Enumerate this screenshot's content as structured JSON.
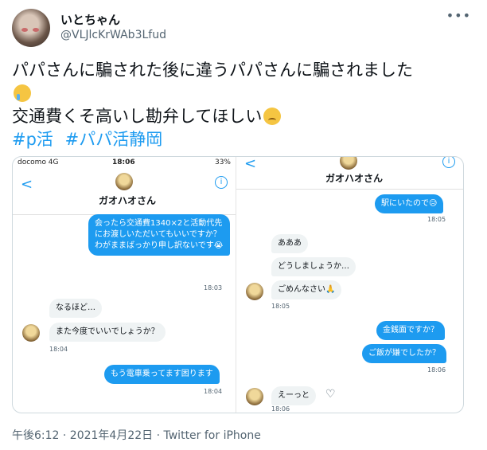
{
  "user": {
    "name": "いとちゃん",
    "handle": "@VLJlcKrWAb3Lfud"
  },
  "more_icon": "more-icon",
  "tweet": {
    "line1": "パパさんに騙された後に違うパパさんに騙されました",
    "line2": "交通費くそ高いし勘弁してほしい",
    "hashtags": [
      "#p活",
      "#パパ活静岡"
    ]
  },
  "left_panel": {
    "status_carrier": "docomo  4G",
    "status_time": "18:06",
    "status_battery": "33%",
    "contact_name": "ガオハオさん",
    "msgs": [
      {
        "text": "会ったら交通費1340×2と活動代先にお渡しいただいてもいいですか？わがままばっかり申し訳ないです😭",
        "time": "18:03"
      },
      {
        "text": "なるほど…"
      },
      {
        "text": "また今度でいいでしょうか？",
        "time": "18:04"
      },
      {
        "text": "もう電車乗ってます困ります",
        "time": "18:04"
      }
    ]
  },
  "right_panel": {
    "contact_name": "ガオハオさん",
    "msgs": [
      {
        "text": "駅にいたので😥",
        "time": "18:05"
      },
      {
        "text": "あああ"
      },
      {
        "text": "どうしましょうか…"
      },
      {
        "text": "ごめんなさい🙏",
        "time": "18:05"
      },
      {
        "text": "金銭面ですか？"
      },
      {
        "text": "ご飯が嫌でしたか？",
        "time": "18:06"
      },
      {
        "text": "えーっと",
        "time": "18:06"
      }
    ]
  },
  "footer": {
    "time": "午後6:12 · 2021年4月22日 · ",
    "source": "Twitter for iPhone"
  },
  "colors": {
    "accent": "#1d9bf0",
    "muted": "#536471"
  }
}
